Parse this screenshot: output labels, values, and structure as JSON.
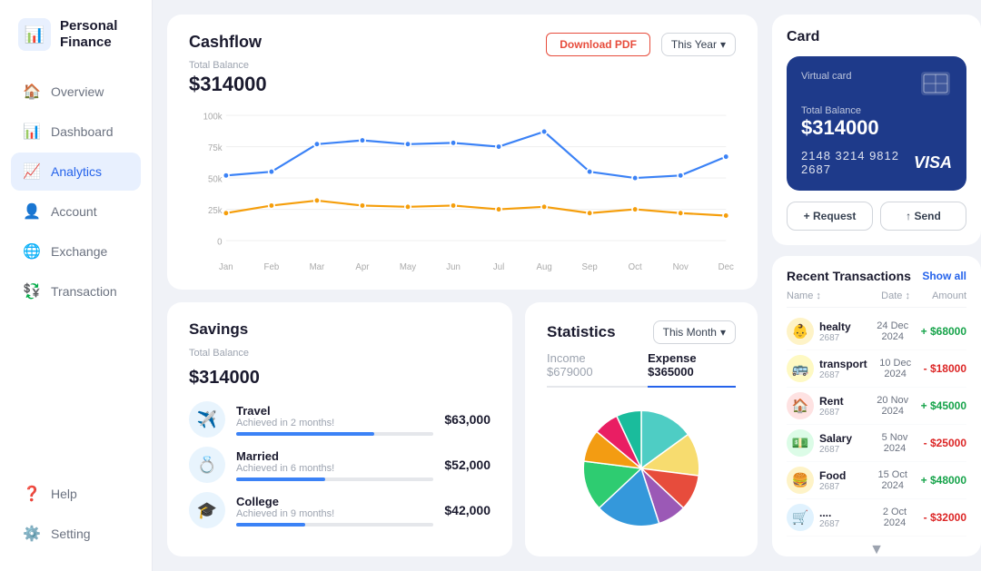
{
  "sidebar": {
    "logo_icon": "📊",
    "logo_text": "Personal\nFinance",
    "items": [
      {
        "id": "overview",
        "label": "Overview",
        "icon": "🏠",
        "active": false
      },
      {
        "id": "dashboard",
        "label": "Dashboard",
        "icon": "📊",
        "active": false
      },
      {
        "id": "analytics",
        "label": "Analytics",
        "icon": "📈",
        "active": true
      },
      {
        "id": "account",
        "label": "Account",
        "icon": "👤",
        "active": false
      },
      {
        "id": "exchange",
        "label": "Exchange",
        "icon": "🌐",
        "active": false
      },
      {
        "id": "transaction",
        "label": "Transaction",
        "icon": "💱",
        "active": false
      }
    ],
    "bottom_items": [
      {
        "id": "help",
        "label": "Help",
        "icon": "❓"
      },
      {
        "id": "setting",
        "label": "Setting",
        "icon": "⚙️"
      }
    ]
  },
  "cashflow": {
    "title": "Cashflow",
    "total_balance_label": "Total Balance",
    "total_balance": "$314000",
    "download_pdf": "Download PDF",
    "year_select": "This Year",
    "chart": {
      "months": [
        "Jan",
        "Feb",
        "Mar",
        "Apr",
        "May",
        "Jun",
        "Jul",
        "Aug",
        "Sep",
        "Oct",
        "Nov",
        "Dec"
      ],
      "blue_line": [
        52,
        55,
        77,
        80,
        77,
        78,
        75,
        87,
        55,
        50,
        52,
        67
      ],
      "orange_line": [
        22,
        28,
        32,
        28,
        27,
        28,
        25,
        27,
        22,
        25,
        22,
        20
      ]
    }
  },
  "savings": {
    "title": "Savings",
    "total_balance_label": "Total Balance",
    "total_balance": "$314000",
    "items": [
      {
        "icon": "✈️",
        "name": "Travel",
        "sub": "Achieved in 2 months!",
        "amount": "$63,000",
        "progress": 70,
        "color": "#3b82f6"
      },
      {
        "icon": "💍",
        "name": "Married",
        "sub": "Achieved in 6 months!",
        "amount": "$52,000",
        "progress": 45,
        "color": "#3b82f6"
      },
      {
        "icon": "🎓",
        "name": "College",
        "sub": "Achieved in 9 months!",
        "amount": "$42,000",
        "progress": 35,
        "color": "#3b82f6"
      }
    ]
  },
  "statistics": {
    "title": "Statistics",
    "month_select": "This Month",
    "tabs": [
      {
        "label": "Income $679000",
        "active": false
      },
      {
        "label": "Expense $365000",
        "active": true
      }
    ],
    "pie_segments": [
      {
        "color": "#4ecdc4",
        "value": 15
      },
      {
        "color": "#f7dc6f",
        "value": 12
      },
      {
        "color": "#e74c3c",
        "value": 10
      },
      {
        "color": "#9b59b6",
        "value": 8
      },
      {
        "color": "#3498db",
        "value": 18
      },
      {
        "color": "#2ecc71",
        "value": 14
      },
      {
        "color": "#f39c12",
        "value": 9
      },
      {
        "color": "#e91e63",
        "value": 7
      },
      {
        "color": "#1abc9c",
        "value": 7
      }
    ]
  },
  "card_widget": {
    "title": "Card",
    "virtual_card_label": "Virtual card",
    "balance_label": "Total Balance",
    "balance": "$314000",
    "card_number": "2148 3214 9812 2687",
    "card_brand": "VISA",
    "request_btn": "+ Request",
    "send_btn": "↑ Send"
  },
  "recent_transactions": {
    "title": "Recent Transactions",
    "show_all": "Show all",
    "col_name": "Name",
    "col_date": "Date",
    "col_amount": "Amount",
    "items": [
      {
        "icon": "👶",
        "bg": "#fef3c7",
        "name": "healty",
        "id": "2687",
        "date": "24 Dec 2024",
        "amount": "+ $68000",
        "positive": true
      },
      {
        "icon": "🚌",
        "bg": "#fef9c3",
        "name": "transport",
        "id": "2687",
        "date": "10 Dec 2024",
        "amount": "- $18000",
        "positive": false
      },
      {
        "icon": "🏠",
        "bg": "#fee2e2",
        "name": "Rent",
        "id": "2687",
        "date": "20 Nov 2024",
        "amount": "+ $45000",
        "positive": true
      },
      {
        "icon": "💵",
        "bg": "#dcfce7",
        "name": "Salary",
        "id": "2687",
        "date": "5 Nov 2024",
        "amount": "- $25000",
        "positive": false
      },
      {
        "icon": "🍔",
        "bg": "#fef3c7",
        "name": "Food",
        "id": "2687",
        "date": "15 Oct 2024",
        "amount": "+ $48000",
        "positive": true
      },
      {
        "icon": "🛒",
        "bg": "#e0f2fe",
        "name": "....",
        "id": "2687",
        "date": "2 Oct 2024",
        "amount": "- $32000",
        "positive": false
      }
    ],
    "more_icon": "▼"
  }
}
